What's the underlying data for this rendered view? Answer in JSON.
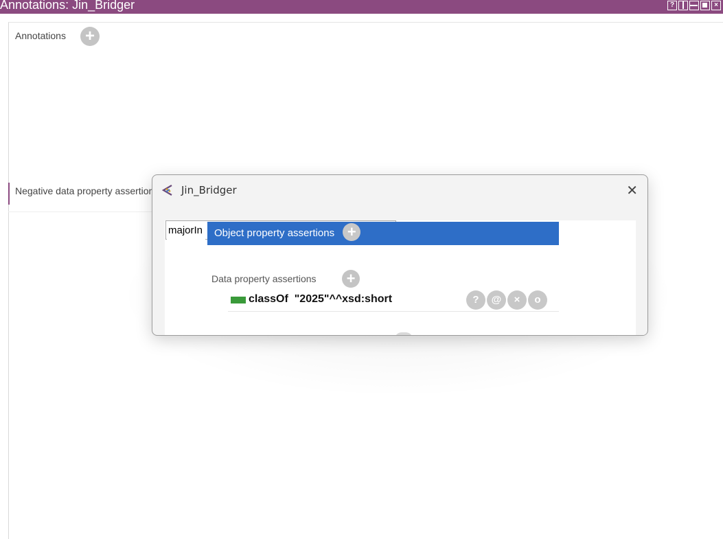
{
  "window": {
    "title": "Annotations: Jin_Bridger",
    "buttons": [
      "?",
      "",
      "",
      "",
      "×"
    ]
  },
  "panel": {
    "annotations_label": "Annotations",
    "negative_label": "Negative data property assertions"
  },
  "dialog": {
    "title": "Jin_Bridger",
    "close_symbol": "✕",
    "input_value": "majorIn",
    "highlight_label": "Object property assertions",
    "data_property_label": "Data property assertions",
    "assertion": {
      "property": "classOf",
      "value": "\"2025\"^^xsd:short",
      "swatch_color": "#3a9a3a"
    },
    "row_buttons": [
      "?",
      "@",
      "×",
      "o"
    ]
  },
  "colors": {
    "title_bar": "#8b4a80",
    "highlight": "#2e6ec7"
  }
}
